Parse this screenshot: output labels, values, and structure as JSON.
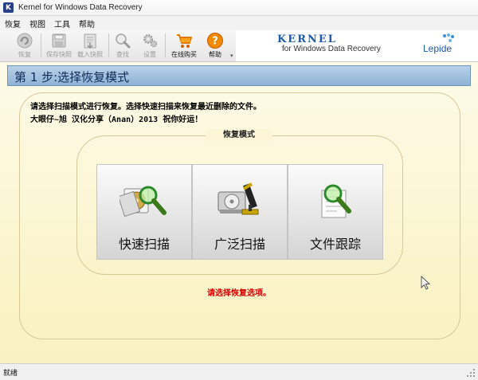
{
  "window": {
    "title": "Kernel for Windows Data Recovery",
    "app_icon_letter": "K"
  },
  "menu": [
    "恢复",
    "视图",
    "工具",
    "帮助"
  ],
  "toolbar": {
    "buttons": [
      {
        "label": "恢复",
        "icon": "recover-icon",
        "enabled": false
      },
      {
        "label": "保存快照",
        "icon": "save-snapshot-icon",
        "enabled": false
      },
      {
        "label": "载入快照",
        "icon": "load-snapshot-icon",
        "enabled": false
      },
      {
        "label": "查找",
        "icon": "search-icon",
        "enabled": false
      },
      {
        "label": "设置",
        "icon": "gear-icon",
        "enabled": false
      },
      {
        "label": "在线购买",
        "icon": "cart-icon",
        "enabled": true
      },
      {
        "label": "帮助",
        "icon": "help-icon",
        "enabled": true
      }
    ]
  },
  "brand": {
    "name": "KERNEL",
    "subtitle": "for Windows Data Recovery",
    "vendor": "Lepide"
  },
  "step": {
    "title": "第 1 步:选择恢复模式"
  },
  "instructions": {
    "line1": "请选择扫描模式进行恢复。选择快速扫描来恢复最近删除的文件。",
    "line2": "大眼仔~旭 汉化分享（Anan）2013 祝你好运！"
  },
  "recovery_modes": {
    "legend": "恢复模式",
    "options": [
      {
        "label": "快速扫描",
        "icon": "quick-scan-icon"
      },
      {
        "label": "广泛扫描",
        "icon": "extensive-scan-icon"
      },
      {
        "label": "文件跟踪",
        "icon": "file-trace-icon"
      }
    ]
  },
  "prompt": "请选择恢复选项。",
  "status": {
    "text": "就绪"
  },
  "colors": {
    "accent": "#1d5aa8",
    "warning": "#d60000",
    "cart": "#f08a00"
  }
}
